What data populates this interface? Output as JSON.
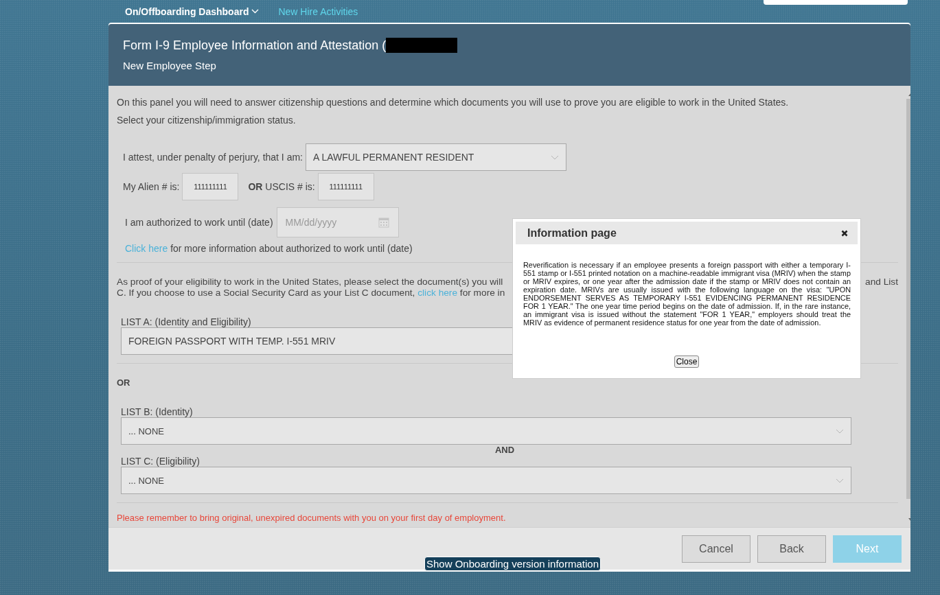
{
  "nav": {
    "items": [
      {
        "label": "On/Offboarding Dashboard",
        "kind": "dropdown"
      },
      {
        "label": "New Hire Activities",
        "kind": "link"
      }
    ]
  },
  "form": {
    "title": "Form I-9 Employee Information and Attestation (",
    "subtitle": "New Employee Step",
    "intro": [
      "On this panel you will need to answer citizenship questions and determine which documents you will use to prove you are eligible to work in the United States.",
      "Select your citizenship/immigration status."
    ],
    "status_label": "I attest, under penalty of perjury, that I am:",
    "status_value": "A LAWFUL PERMANENT RESIDENT",
    "alien_label": "My Alien # is:",
    "alien_value": "111111111",
    "or_label": "OR",
    "uscis_label": "USCIS # is:",
    "uscis_value": "111111111",
    "work_until_label": "I am authorized to work until (date)",
    "date_placeholder": "MM/dd/yyyy",
    "info_link": "Click here",
    "info_text": "for more information about authorized to work until (date)",
    "proof_line1_left": "As proof of your eligibility to work in the United States, please select the document(s) you will",
    "proof_line1_right": "and List",
    "proof_line2_left": "C. If you choose to use a Social Security Card as your List C document,",
    "proof_link": "click here",
    "proof_line2_right": "for more in",
    "list_a_label": "LIST A:  (Identity and Eligibility)",
    "list_a_value": "FOREIGN PASSPORT WITH TEMP. I-551 MRIV",
    "or_text": "OR",
    "list_b_label": "LIST B: (Identity)",
    "list_b_value": "... NONE",
    "and_text": "AND",
    "list_c_label": "LIST C: (Eligibility)",
    "list_c_value": "... NONE",
    "reminder": "Please remember to bring original, unexpired documents with you on your first day of employment."
  },
  "buttons": [
    {
      "label": "Cancel",
      "kind": "default"
    },
    {
      "label": "Back",
      "kind": "default"
    },
    {
      "label": "Next",
      "kind": "primary"
    }
  ],
  "version_tooltip": "Show Onboarding version information",
  "dialog": {
    "title": "Information page",
    "body": "Reverification is necessary if an employee presents a foreign passport with either a temporary I-551 stamp or I-551 printed notation on a machine-readable immigrant visa (MRIV) when the stamp or MRIV expires, or one year after the admission date if the stamp or MRIV does not contain an expiration date. MRIVs are usually issued with the following language on the visa: \"UPON ENDORSEMENT SERVES AS TEMPORARY I-551 EVIDENCING PERMANENT RESIDENCE FOR 1 YEAR.\" The one year time period begins on the date of admission. If, in the rare instance, an immigrant visa is issued without the statement \"FOR 1 YEAR,\" employers should treat the MRIV as evidence of permanent residence status for one year from the date of admission.",
    "button": "Close"
  }
}
